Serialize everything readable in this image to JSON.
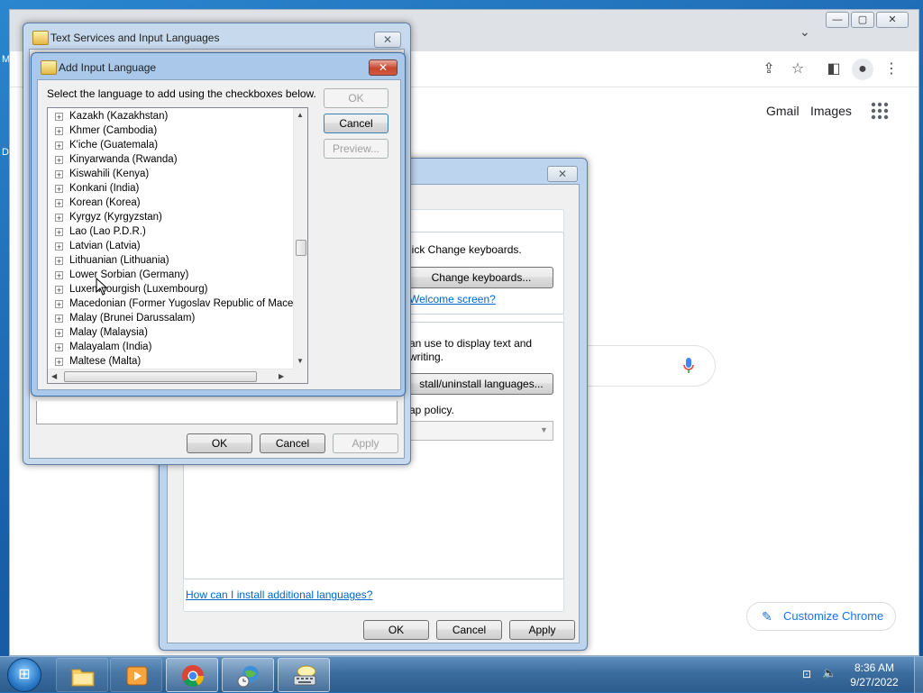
{
  "desktop": {
    "edge_label_1": "M",
    "edge_label_2": "D"
  },
  "chrome": {
    "caption_minimize": "—",
    "caption_maximize": "▢",
    "caption_close": "✕",
    "tab_dropdown": "⌄",
    "links": {
      "gmail": "Gmail",
      "images": "Images"
    },
    "customize_label": "Customize Chrome"
  },
  "regional_dialog": {
    "close_glyph": "✕",
    "keyboards_text": "lick Change keyboards.",
    "change_keyboards_button": "Change keyboards...",
    "welcome_link": "Welcome screen?",
    "display_text_1": "an use to display text and",
    "display_text_2": "writing.",
    "install_button": "stall/uninstall languages...",
    "policy_text": "ap policy.",
    "help_link": "How can I install additional languages?",
    "ok": "OK",
    "cancel": "Cancel",
    "apply": "Apply"
  },
  "text_services_dialog": {
    "title": "Text Services and Input Languages",
    "close_glyph": "✕",
    "ok": "OK",
    "cancel": "Cancel",
    "apply": "Apply"
  },
  "add_input_dialog": {
    "title": "Add Input Language",
    "close_glyph": "✕",
    "instruction": "Select the language to add using the checkboxes below.",
    "ok": "OK",
    "cancel": "Cancel",
    "preview": "Preview...",
    "languages": [
      "Kazakh (Kazakhstan)",
      "Khmer (Cambodia)",
      "K'iche (Guatemala)",
      "Kinyarwanda (Rwanda)",
      "Kiswahili (Kenya)",
      "Konkani (India)",
      "Korean (Korea)",
      "Kyrgyz (Kyrgyzstan)",
      "Lao (Lao P.D.R.)",
      "Latvian (Latvia)",
      "Lithuanian (Lithuania)",
      "Lower Sorbian (Germany)",
      "Luxembourgish (Luxembourg)",
      "Macedonian (Former Yugoslav Republic of Macedonia)",
      "Malay (Brunei Darussalam)",
      "Malay (Malaysia)",
      "Malayalam (India)",
      "Maltese (Malta)"
    ]
  },
  "taskbar": {
    "time": "8:36 AM",
    "date": "9/27/2022"
  },
  "colors": {
    "desktop": "#1f6fb6",
    "link": "#0066cc",
    "chrome_accent": "#1a73e8",
    "close_red": "#c7452f"
  }
}
